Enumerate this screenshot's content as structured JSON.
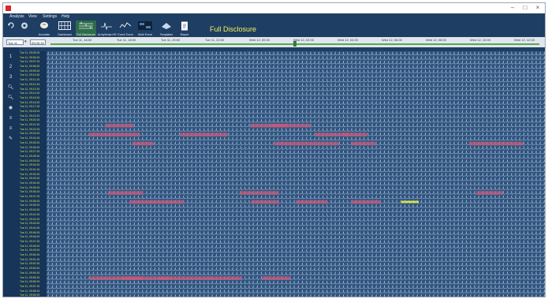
{
  "window": {
    "controls": [
      "–",
      "□",
      "×"
    ]
  },
  "menu": [
    "Analysis",
    "View",
    "Settings",
    "Help"
  ],
  "toolbar": {
    "title": "Full Disclosure",
    "buttons": [
      {
        "label": "",
        "icon": "undo-icon"
      },
      {
        "label": "",
        "icon": "settings-icon"
      },
      {
        "label": "Annotate",
        "icon": "annotate-icon"
      },
      {
        "label": "Dashboard",
        "icon": "dashboard-icon"
      },
      {
        "label": "Full Disclosure",
        "icon": "full-disclosure-icon"
      },
      {
        "label": "Arrhythmia HR",
        "icon": "arrhythmia-icon"
      },
      {
        "label": "Event Trend",
        "icon": "event-trend-icon"
      },
      {
        "label": "Multi Event",
        "icon": "multi-event-icon"
      },
      {
        "label": "Templates",
        "icon": "templates-icon"
      },
      {
        "label": "Report",
        "icon": "report-icon"
      }
    ]
  },
  "timeline": {
    "start_value": "Tue 11",
    "time_value": "09:05:15",
    "ticks": [
      "Tue 11, 16:00",
      "Tue 11, 18:00",
      "Tue 11, 20:00",
      "Tue 11, 22:00",
      "Wed 12, 00:00",
      "Wed 12, 02:00",
      "Wed 12, 04:00",
      "Wed 12, 06:00",
      "Wed 12, 08:00",
      "Wed 12, 10:00",
      "Wed 12, 12:00"
    ],
    "position_fraction": 0.5
  },
  "sidebar": [
    "1",
    "2",
    "3",
    "zoom-in",
    "zoom-out",
    "alarm",
    "list",
    "list",
    "edit"
  ],
  "strip": {
    "row_count": 55,
    "row_label_prefix": "Tue 11, 09:",
    "highlight_rows": [
      16,
      18,
      20,
      31,
      33,
      50
    ]
  },
  "colors": {
    "background": "#2e5480",
    "trace": "#e8edf5",
    "event_red": "#c65a7a",
    "event_yellow": "#d8e04a",
    "label_green": "#cfe05a",
    "title_yellow": "#f1ef5a"
  }
}
